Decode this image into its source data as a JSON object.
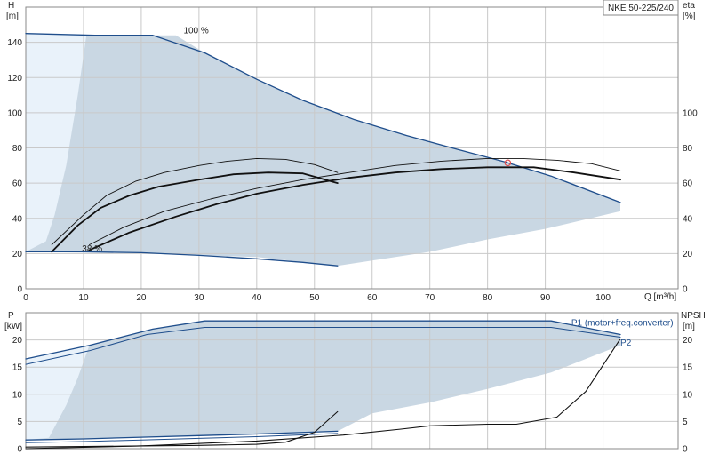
{
  "colors": {
    "envelope": "#c9d7e3",
    "envelope_light": "#e9f2fa",
    "curve_blue": "#1f4e8c",
    "curve_black": "#111111",
    "grid": "#c9c9c9",
    "duty_point": "#e05050"
  },
  "chart_data": [
    {
      "type": "line",
      "id": "head_curves",
      "title": "NKE 50-225/240",
      "ylabel_left": "H",
      "ylabel_left_unit": "[m]",
      "ylabel_right": "eta",
      "ylabel_right_unit": "[%]",
      "xlabel": "Q [m³/h]",
      "xlim": [
        0,
        113
      ],
      "ylim": [
        0,
        160
      ],
      "x_ticks": [
        0,
        10,
        20,
        30,
        40,
        50,
        60,
        70,
        80,
        90,
        100
      ],
      "y_ticks": [
        0,
        20,
        40,
        60,
        80,
        100,
        120,
        140
      ],
      "y_ticks_right": [
        0,
        20,
        40,
        60,
        80,
        100
      ],
      "grid": true,
      "annotations": [
        {
          "text": "100 %",
          "x": 29.5,
          "y": 147
        },
        {
          "text": "38 %",
          "x": 11.5,
          "y": 23
        }
      ],
      "envelope": [
        [
          0,
          145
        ],
        [
          10.5,
          144
        ],
        [
          22,
          144
        ],
        [
          26,
          144
        ],
        [
          31,
          134
        ],
        [
          40,
          119
        ],
        [
          48,
          107
        ],
        [
          57,
          96
        ],
        [
          66,
          87
        ],
        [
          75,
          79
        ],
        [
          83,
          72
        ],
        [
          91,
          64
        ],
        [
          103,
          49
        ],
        [
          103,
          44
        ],
        [
          90,
          34
        ],
        [
          80,
          28
        ],
        [
          70,
          21
        ],
        [
          54,
          13
        ],
        [
          54,
          13
        ],
        [
          40,
          18
        ],
        [
          20,
          20
        ],
        [
          0,
          21
        ]
      ],
      "envelope_light": [
        [
          0,
          145
        ],
        [
          10.5,
          144
        ],
        [
          9,
          110
        ],
        [
          7,
          70
        ],
        [
          5,
          42
        ],
        [
          3.5,
          27
        ],
        [
          0,
          21
        ]
      ],
      "series": [
        {
          "name": "head_100",
          "color_key": "curve_blue",
          "width": 1.3,
          "points": [
            [
              0,
              145
            ],
            [
              12,
              144
            ],
            [
              22,
              144
            ],
            [
              31,
              134
            ],
            [
              40,
              119
            ],
            [
              48,
              107
            ],
            [
              57,
              96
            ],
            [
              66,
              87
            ],
            [
              75,
              79
            ],
            [
              83,
              72
            ],
            [
              91,
              64
            ],
            [
              103,
              49
            ]
          ]
        },
        {
          "name": "head_38",
          "color_key": "curve_blue",
          "width": 1.3,
          "points": [
            [
              0,
              21
            ],
            [
              10,
              21
            ],
            [
              20,
              20.5
            ],
            [
              30,
              19
            ],
            [
              40,
              17
            ],
            [
              48,
              15
            ],
            [
              54,
              13
            ]
          ]
        },
        {
          "name": "eta_max_left",
          "color_key": "curve_black",
          "width": 1.8,
          "points": [
            [
              4.5,
              21
            ],
            [
              9,
              36
            ],
            [
              13,
              46
            ],
            [
              18,
              53
            ],
            [
              23,
              58
            ],
            [
              30,
              62
            ],
            [
              36,
              65
            ],
            [
              42,
              66
            ],
            [
              48,
              65.5
            ],
            [
              54,
              60
            ]
          ]
        },
        {
          "name": "eta_max_right",
          "color_key": "curve_black",
          "width": 1.8,
          "points": [
            [
              11,
              22
            ],
            [
              18,
              32
            ],
            [
              26,
              41
            ],
            [
              33,
              48
            ],
            [
              40,
              54
            ],
            [
              48,
              59
            ],
            [
              56,
              63
            ],
            [
              64,
              66
            ],
            [
              72,
              68
            ],
            [
              80,
              69
            ],
            [
              88,
              69
            ],
            [
              95,
              66
            ],
            [
              103,
              62
            ]
          ]
        },
        {
          "name": "eta_outer_left",
          "color_key": "curve_black",
          "width": 0.9,
          "points": [
            [
              4.5,
              25
            ],
            [
              10,
              42
            ],
            [
              14,
              53
            ],
            [
              19,
              61
            ],
            [
              24,
              66
            ],
            [
              30,
              70
            ],
            [
              35,
              72.5
            ],
            [
              40,
              74
            ],
            [
              45,
              73.5
            ],
            [
              50,
              70.5
            ],
            [
              54,
              66
            ]
          ]
        },
        {
          "name": "eta_outer_right",
          "color_key": "curve_black",
          "width": 0.9,
          "points": [
            [
              11,
              25
            ],
            [
              17,
              35
            ],
            [
              24,
              44
            ],
            [
              32,
              51
            ],
            [
              40,
              57
            ],
            [
              48,
              62
            ],
            [
              56,
              66
            ],
            [
              64,
              70
            ],
            [
              72,
              72.5
            ],
            [
              80,
              74
            ],
            [
              86,
              74
            ],
            [
              92,
              73
            ],
            [
              98,
              71
            ],
            [
              103,
              67
            ]
          ]
        }
      ],
      "duty_point": {
        "x": 83.5,
        "y": 71.5
      }
    },
    {
      "type": "line",
      "id": "power_curves",
      "ylabel_left": "P",
      "ylabel_left_unit": "[kW]",
      "ylabel_right": "NPSH",
      "ylabel_right_unit": "[m]",
      "xlim": [
        0,
        113
      ],
      "ylim": [
        0,
        25
      ],
      "x_ticks": [
        0,
        10,
        20,
        30,
        40,
        50,
        60,
        70,
        80,
        90,
        100
      ],
      "y_ticks": [
        0,
        5,
        10,
        15,
        20
      ],
      "y_ticks_right": [
        0,
        5,
        10,
        15,
        20
      ],
      "grid": true,
      "envelope": [
        [
          0,
          16.5
        ],
        [
          11,
          19
        ],
        [
          22,
          22
        ],
        [
          31,
          23.5
        ],
        [
          91,
          23.5
        ],
        [
          103,
          21
        ],
        [
          103,
          19
        ],
        [
          91,
          14
        ],
        [
          80,
          11
        ],
        [
          70,
          8.5
        ],
        [
          60,
          6.5
        ],
        [
          54,
          3.2
        ],
        [
          40,
          2.7
        ],
        [
          20,
          2.1
        ],
        [
          0,
          1.6
        ]
      ],
      "envelope_light": [
        [
          0,
          16.5
        ],
        [
          11,
          19
        ],
        [
          9,
          13
        ],
        [
          7,
          8
        ],
        [
          5,
          4
        ],
        [
          4,
          2
        ],
        [
          0,
          1.6
        ]
      ],
      "series_labels": [
        {
          "text": "P1 (motor+freq.converter)",
          "color_key": "curve_blue",
          "x": 94.5,
          "y": 23.2
        },
        {
          "text": "P2",
          "color_key": "curve_blue",
          "x": 103,
          "y": 19.5
        }
      ],
      "series": [
        {
          "name": "P1 (motor+freq.converter)",
          "color_key": "curve_blue",
          "width": 1.3,
          "points": [
            [
              0,
              16.5
            ],
            [
              11,
              19
            ],
            [
              22,
              22
            ],
            [
              31,
              23.5
            ],
            [
              91,
              23.5
            ],
            [
              103,
              21
            ]
          ]
        },
        {
          "name": "P2",
          "color_key": "curve_blue",
          "width": 1.0,
          "points": [
            [
              0,
              15.5
            ],
            [
              11,
              18
            ],
            [
              21,
              21
            ],
            [
              31,
              22.3
            ],
            [
              91,
              22.3
            ],
            [
              103,
              20.5
            ]
          ]
        },
        {
          "name": "p_low_1",
          "color_key": "curve_blue",
          "width": 1.3,
          "points": [
            [
              0,
              1.6
            ],
            [
              10,
              1.8
            ],
            [
              20,
              2.1
            ],
            [
              30,
              2.4
            ],
            [
              40,
              2.7
            ],
            [
              54,
              3.2
            ]
          ]
        },
        {
          "name": "p_low_2",
          "color_key": "curve_blue",
          "width": 1.0,
          "points": [
            [
              0,
              1.1
            ],
            [
              10,
              1.3
            ],
            [
              20,
              1.6
            ],
            [
              30,
              1.9
            ],
            [
              40,
              2.2
            ],
            [
              54,
              2.8
            ]
          ]
        },
        {
          "name": "npsh_low",
          "color_key": "curve_black",
          "width": 1.1,
          "points": [
            [
              0,
              0.3
            ],
            [
              10,
              0.4
            ],
            [
              20,
              0.5
            ],
            [
              30,
              0.6
            ],
            [
              40,
              0.8
            ],
            [
              45,
              1.2
            ],
            [
              50,
              3
            ],
            [
              54,
              6.8
            ]
          ]
        },
        {
          "name": "npsh_max",
          "color_key": "curve_black",
          "width": 1.1,
          "points": [
            [
              0,
              0
            ],
            [
              20,
              0.5
            ],
            [
              40,
              1.4
            ],
            [
              55,
              2.5
            ],
            [
              65,
              3.6
            ],
            [
              70,
              4.2
            ],
            [
              80,
              4.5
            ],
            [
              85,
              4.5
            ],
            [
              92,
              5.8
            ],
            [
              97,
              10.5
            ],
            [
              103,
              20.2
            ]
          ]
        }
      ]
    }
  ]
}
